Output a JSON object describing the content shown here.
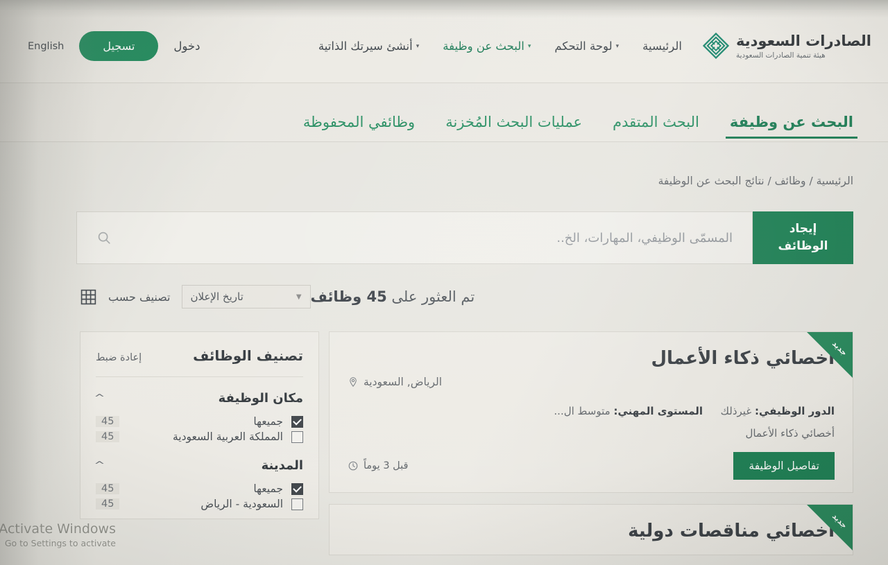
{
  "brand": {
    "title": "الصادرات السعودية",
    "subtitle": "هيئة تنمية الصادرات السعودية",
    "logo_color": "#17856b"
  },
  "header": {
    "nav": [
      {
        "label": "الرئيسية",
        "accent": false,
        "caret": false
      },
      {
        "label": "لوحة التحكم",
        "accent": false,
        "caret": true
      },
      {
        "label": "البحث عن وظيفة",
        "accent": true,
        "caret": true
      },
      {
        "label": "أنشئ سيرتك الذاتية",
        "accent": false,
        "caret": true
      }
    ],
    "login_label": "دخول",
    "register_label": "تسجيل",
    "language_label": "English"
  },
  "tabs": [
    {
      "label": "البحث عن وظيفة",
      "active": true
    },
    {
      "label": "البحث المتقدم",
      "active": false
    },
    {
      "label": "عمليات البحث المُخزنة",
      "active": false
    },
    {
      "label": "وظائفي المحفوظة",
      "active": false
    }
  ],
  "breadcrumb": "الرئيسية / وظائف / نتائج البحث عن الوظيفة",
  "search": {
    "placeholder": "المسمّى الوظيفي، المهارات، الخ..",
    "value": "",
    "button_line1": "إيجاد",
    "button_line2": "الوظائف"
  },
  "toolbar": {
    "result_count_prefix": "تم العثور على ",
    "result_count_number": "45",
    "result_count_suffix": " وظائف",
    "sort_label": "تصنيف حسب",
    "sort_selected": "تاريخ الإعلان"
  },
  "filters": {
    "title": "تصنيف الوظائف",
    "reset_label": "إعادة ضبط",
    "groups": [
      {
        "title": "مكان الوظيفة",
        "options": [
          {
            "label": "جميعها",
            "count": "45",
            "checked": true
          },
          {
            "label": "المملكة العربية السعودية",
            "count": "45",
            "checked": false
          }
        ]
      },
      {
        "title": "المدينة",
        "options": [
          {
            "label": "جميعها",
            "count": "45",
            "checked": true
          },
          {
            "label": "السعودية - الرياض",
            "count": "45",
            "checked": false
          }
        ]
      }
    ]
  },
  "jobs": [
    {
      "badge": "جديد",
      "title": "اخصائي ذكاء الأعمال",
      "location": "الرياض, السعودية",
      "role_label": "الدور الوظيفي:",
      "role_value": "غيرذلك",
      "level_label": "المستوى المهني:",
      "level_value": "متوسط ال...",
      "description": "أخصائي ذكاء الأعمال",
      "details_button": "تفاصيل الوظيفة",
      "age": "قبل 3 يوماً"
    },
    {
      "badge": "جديد",
      "title": "اخصائي مناقصات دولية",
      "location": "",
      "role_label": "",
      "role_value": "",
      "level_label": "",
      "level_value": "",
      "description": "",
      "details_button": "",
      "age": ""
    }
  ],
  "watermark": {
    "title": "Activate Windows",
    "subtitle": "Go to Settings to activate"
  },
  "colors": {
    "brand_green": "#10794b",
    "accent_green": "#1f8a5c",
    "page_bg": "#e6e5df"
  }
}
